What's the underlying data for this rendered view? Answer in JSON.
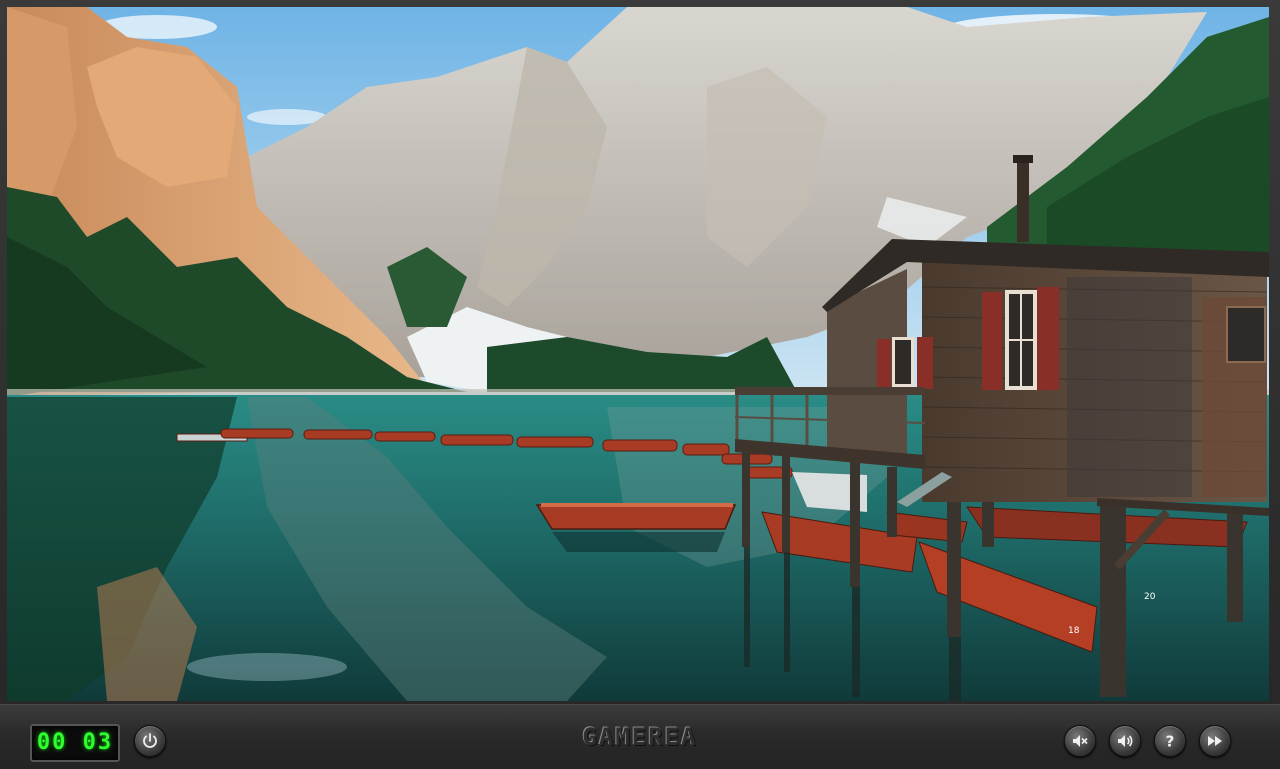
{
  "game": {
    "timer": "00 03",
    "logo_text": "GAMEREA"
  },
  "controls": {
    "power_icon": "power-icon",
    "mute_icon": "mute-icon",
    "volume_icon": "volume-icon",
    "help_icon": "help-icon",
    "skip_icon": "fast-forward-icon"
  },
  "scene": {
    "boat_numbers": [
      "20",
      "18"
    ]
  },
  "colors": {
    "timer_digits": "#2cff2c",
    "water": "#1f6e6b",
    "boat": "#a83b24"
  }
}
